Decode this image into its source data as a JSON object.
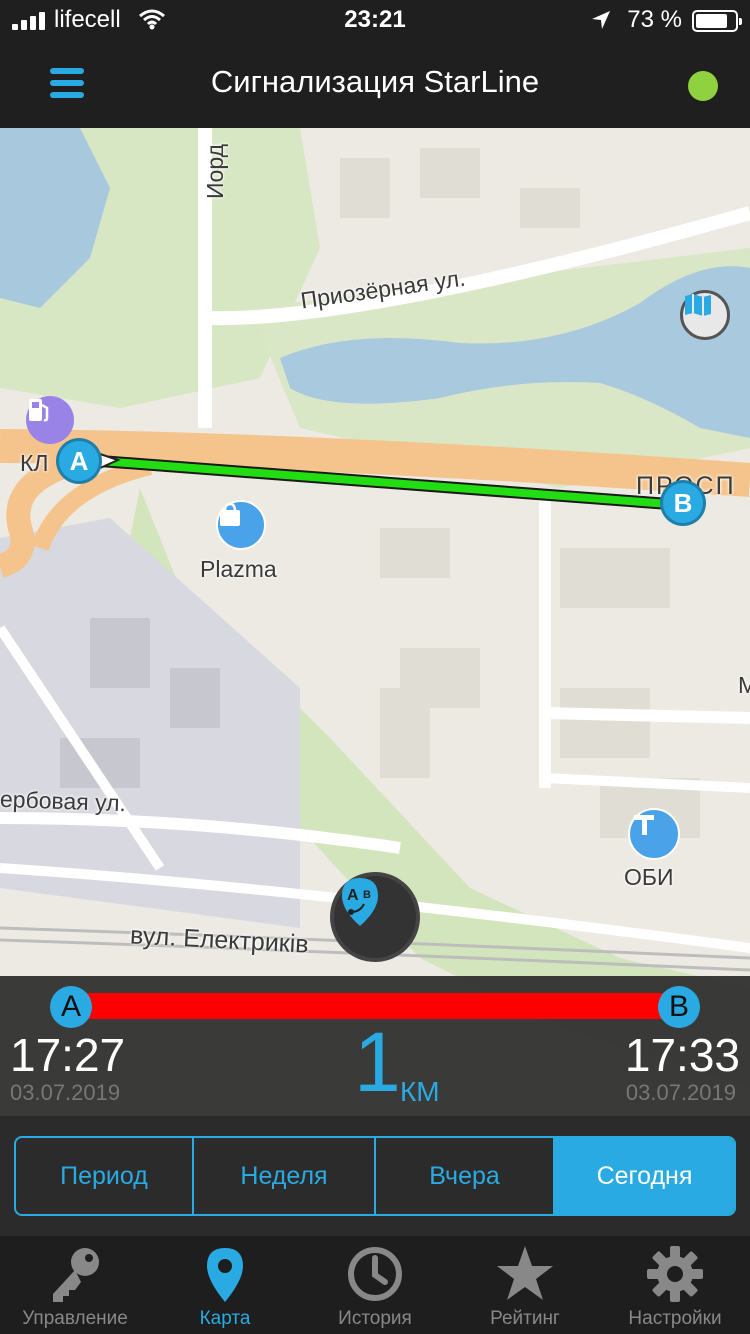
{
  "status_bar": {
    "carrier": "lifecell",
    "time": "23:21",
    "battery_percent": "73 %",
    "battery_level": 0.73,
    "icons": [
      "signal-icon",
      "wifi-icon",
      "location-arrow-icon",
      "battery-icon"
    ]
  },
  "header": {
    "title": "Сигнализация StarLine",
    "menu_icon": "hamburger-menu-icon",
    "status_indicator_color": "#8fd13f"
  },
  "map": {
    "street_labels": [
      "Приозёрная ул.",
      "Иорд",
      "ерб​овая ул.",
      "вул. Електриків",
      "ПРОСП",
      "КЛ",
      "М"
    ],
    "pois": [
      {
        "name": "Plazma",
        "icon": "shopping-bag-icon"
      },
      {
        "name": "ОБИ",
        "icon": "hammer-icon"
      },
      {
        "name": "",
        "icon": "gas-station-icon"
      },
      {
        "name": "",
        "icon": "map-book-icon"
      }
    ],
    "route_start_label": "A",
    "route_end_label": "B",
    "route_color": "#22dd11",
    "trip_toggle_icon": "route-ab-icon"
  },
  "trip": {
    "start_label": "A",
    "end_label": "B",
    "start_time": "17:27",
    "start_date": "03.07.2019",
    "end_time": "17:33",
    "end_date": "03.07.2019",
    "distance_value": "1",
    "distance_unit": "КМ",
    "bar_color": "#ff0000"
  },
  "period_selector": {
    "options": [
      "Период",
      "Неделя",
      "Вчера",
      "Сегодня"
    ],
    "selected": "Сегодня"
  },
  "tab_bar": {
    "items": [
      {
        "label": "Управление",
        "icon": "key-icon"
      },
      {
        "label": "Карта",
        "icon": "map-pin-icon"
      },
      {
        "label": "История",
        "icon": "clock-icon"
      },
      {
        "label": "Рейтинг",
        "icon": "star-icon"
      },
      {
        "label": "Настройки",
        "icon": "gear-icon"
      }
    ],
    "active": "Карта"
  },
  "colors": {
    "accent": "#2aaae2",
    "background": "#1e1e1e"
  }
}
